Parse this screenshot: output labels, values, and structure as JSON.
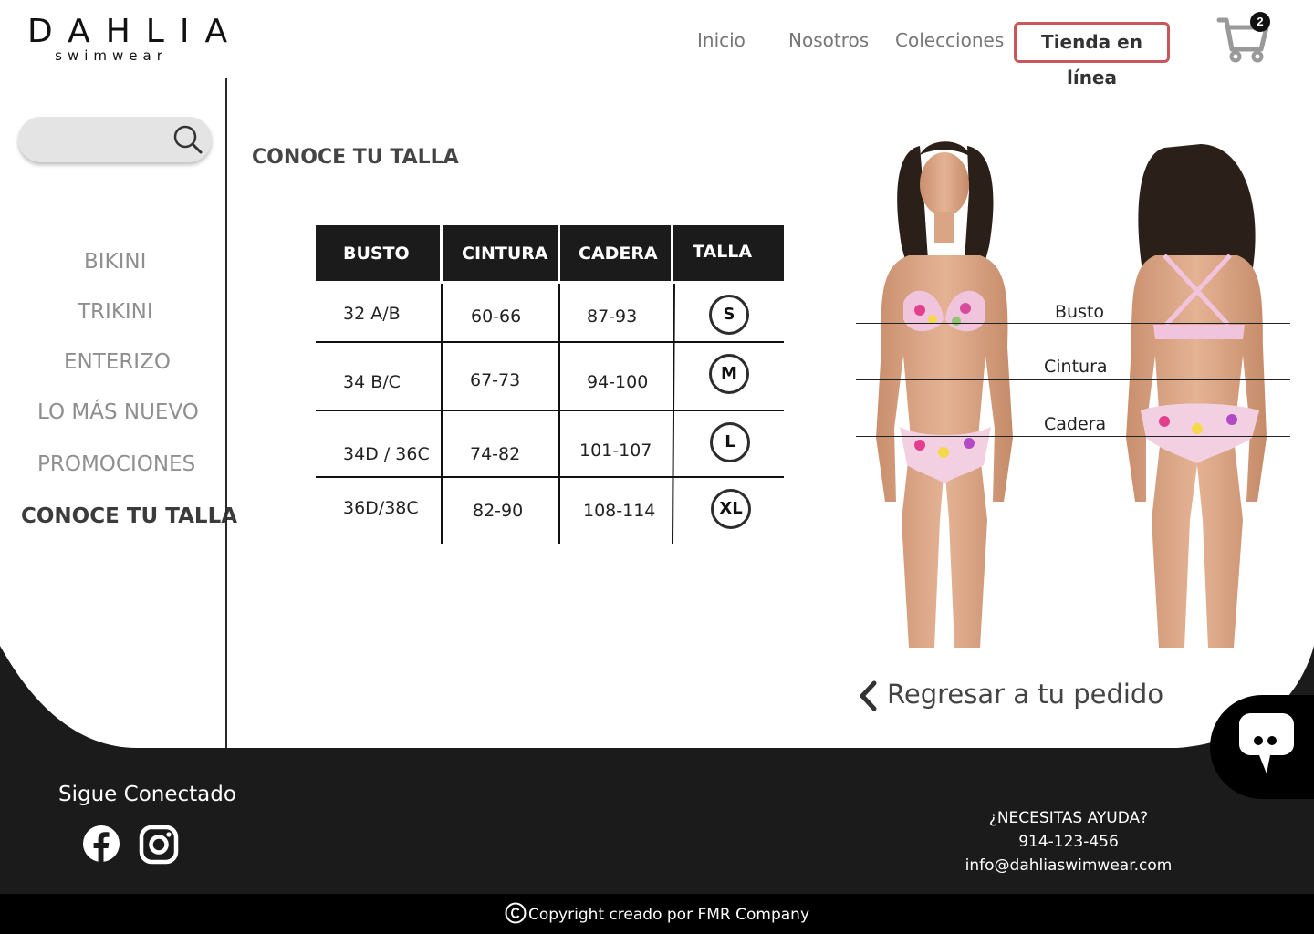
{
  "header": {
    "logo_main": "DAHLIA",
    "logo_sub": "swimwear",
    "nav": [
      "Inicio",
      "Nosotros",
      "Colecciones"
    ],
    "shop_label": "Tienda en línea",
    "cart_count": "2"
  },
  "sidebar": {
    "search_placeholder": "",
    "items": [
      "BIKINI",
      "TRIKINI",
      "ENTERIZO",
      "LO MÁS NUEVO",
      "PROMOCIONES",
      "CONOCE TU TALLA"
    ],
    "active_item": "CONOCE TU TALLA"
  },
  "main": {
    "title": "CONOCE TU TALLA",
    "table": {
      "headers": [
        "BUSTO",
        "CINTURA",
        "CADERA",
        "TALLA"
      ],
      "rows": [
        [
          "32 A/B",
          "60-66",
          "87-93",
          "S"
        ],
        [
          "34 B/C",
          "67-73",
          "94-100",
          "M"
        ],
        [
          "34D / 36C",
          "74-82",
          "101-107",
          "L"
        ],
        [
          "36D/38C",
          "82-90",
          "108-114",
          "XL"
        ]
      ]
    },
    "figure_labels": [
      "Busto",
      "Cintura",
      "Cadera"
    ],
    "back_label": "Regresar a tu pedido"
  },
  "footer": {
    "follow_label": "Sigue Conectado",
    "help_title": "¿NECESITAS AYUDA?",
    "phone": "914-123-456",
    "email": "info@dahliaswimwear.com",
    "copyright": "Copyright creado por FMR Company"
  },
  "colors": {
    "accent": "#c9565c",
    "footer_bg": "#1b1b1b",
    "text_muted": "#8f8f8f"
  },
  "icons": [
    "search-icon",
    "cart-icon",
    "chevron-left-icon",
    "facebook-icon",
    "instagram-icon",
    "chat-icon",
    "copyright-icon"
  ]
}
